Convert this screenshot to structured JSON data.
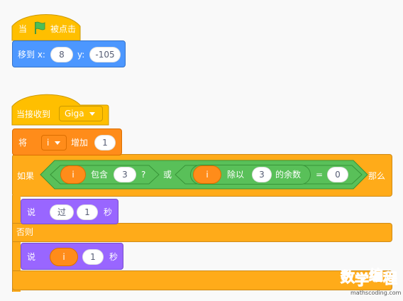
{
  "script1": {
    "hat_prefix": "当",
    "hat_suffix": "被点击",
    "flag_icon": "green-flag-icon",
    "goto_label": "移到 x:",
    "goto_x": "8",
    "goto_y_label": "y:",
    "goto_y": "-105"
  },
  "script2": {
    "hat_label": "当接收到",
    "hat_message": "Giga",
    "change_label": "将",
    "change_var": "i",
    "change_action": "增加",
    "change_value": "1",
    "if_label": "如果",
    "cond1_var": "i",
    "cond1_op": "包含",
    "cond1_value": "3",
    "cond1_q": "?",
    "or_label": "或",
    "cond2_var": "i",
    "cond2_div": "除以",
    "cond2_value": "3",
    "cond2_suffix": "的余数",
    "eq_sign": "=",
    "eq_value": "0",
    "then_label": "那么",
    "say1_label": "说",
    "say1_text": "过",
    "say1_secs": "1",
    "say1_unit": "秒",
    "else_label": "否则",
    "say2_label": "说",
    "say2_var": "i",
    "say2_secs": "1",
    "say2_unit": "秒"
  },
  "watermark": {
    "chars": [
      "数",
      "学",
      "编",
      "程"
    ],
    "url": "mathscoding.com",
    "colors": [
      "#e8383d",
      "#f39800",
      "#2ea7e0",
      "#7cb342"
    ]
  },
  "colors": {
    "events": "#ffbf00",
    "motion": "#4c97ff",
    "variables": "#ff8c1a",
    "control": "#ffab19",
    "operators": "#59c059",
    "looks": "#9966ff"
  }
}
